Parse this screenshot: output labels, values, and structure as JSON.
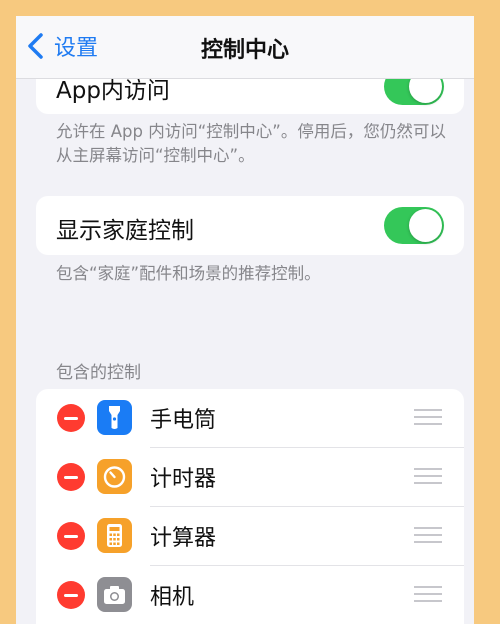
{
  "nav": {
    "back_label": "设置",
    "title": "控制中心"
  },
  "access_in_apps": {
    "label": "App内访问",
    "enabled": true,
    "footnote": "允许在 App 内访问“控制中心”。停用后，您仍然可以从主屏幕访问“控制中心”。"
  },
  "home_controls": {
    "label": "显示家庭控制",
    "enabled": true,
    "footnote": "包含“家庭”配件和场景的推荐控制。"
  },
  "included_controls": {
    "header": "包含的控制",
    "items": [
      {
        "label": "手电筒",
        "icon": "flashlight-icon",
        "color": "#1a7cf5"
      },
      {
        "label": "计时器",
        "icon": "timer-icon",
        "color": "#f6a12a"
      },
      {
        "label": "计算器",
        "icon": "calculator-icon",
        "color": "#f6a12a"
      },
      {
        "label": "相机",
        "icon": "camera-icon",
        "color": "#8e8e93"
      }
    ]
  },
  "colors": {
    "accent": "#1f7bf2",
    "toggle_on": "#34c759",
    "remove": "#ff3b30"
  }
}
